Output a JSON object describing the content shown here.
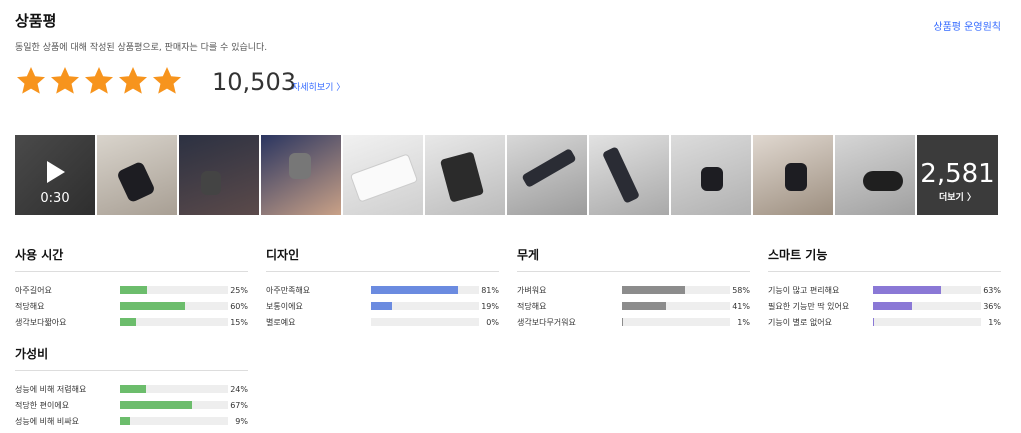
{
  "header": {
    "title": "상품평",
    "subtitle": "동일한 상품에 대해 작성된 상품평으로, 판매자는 다를 수 있습니다.",
    "policy_link": "상품평 운영원칙"
  },
  "rating": {
    "stars": 5,
    "review_count": "10,503",
    "more_link": "자세히보기 〉"
  },
  "gallery": {
    "video_duration": "0:30",
    "more_count": "2,581",
    "more_label": "더보기 〉"
  },
  "surveys": [
    {
      "title": "사용 시간",
      "color": "#6cbd6c",
      "rows": [
        {
          "label": "아주길어요",
          "pct": 25,
          "pct_text": "25%"
        },
        {
          "label": "적당해요",
          "pct": 60,
          "pct_text": "60%"
        },
        {
          "label": "생각보다짧아요",
          "pct": 15,
          "pct_text": "15%"
        }
      ]
    },
    {
      "title": "디자인",
      "color": "#6b8be0",
      "rows": [
        {
          "label": "아주만족해요",
          "pct": 81,
          "pct_text": "81%"
        },
        {
          "label": "보통이에요",
          "pct": 19,
          "pct_text": "19%"
        },
        {
          "label": "별로예요",
          "pct": 0,
          "pct_text": "0%"
        }
      ]
    },
    {
      "title": "무게",
      "color": "#8c8c8c",
      "rows": [
        {
          "label": "가벼워요",
          "pct": 58,
          "pct_text": "58%"
        },
        {
          "label": "적당해요",
          "pct": 41,
          "pct_text": "41%"
        },
        {
          "label": "생각보다무거워요",
          "pct": 1,
          "pct_text": "1%"
        }
      ]
    },
    {
      "title": "스마트 기능",
      "color": "#8a78d6",
      "rows": [
        {
          "label": "기능이 많고 편리해요",
          "pct": 63,
          "pct_text": "63%"
        },
        {
          "label": "필요한 기능만 딱 있어요",
          "pct": 36,
          "pct_text": "36%"
        },
        {
          "label": "기능이 별로 없어요",
          "pct": 1,
          "pct_text": "1%"
        }
      ]
    },
    {
      "title": "가성비",
      "color": "#6cbd6c",
      "rows": [
        {
          "label": "성능에 비해 저렴해요",
          "pct": 24,
          "pct_text": "24%"
        },
        {
          "label": "적당한 편이에요",
          "pct": 67,
          "pct_text": "67%"
        },
        {
          "label": "성능에 비해 비싸요",
          "pct": 9,
          "pct_text": "9%"
        }
      ]
    }
  ]
}
